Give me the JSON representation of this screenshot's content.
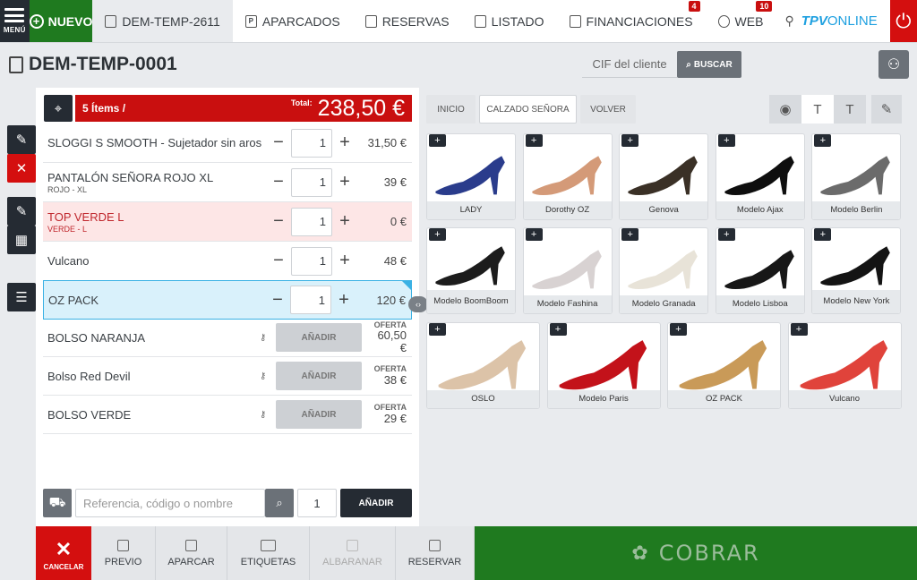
{
  "topbar": {
    "menu_label": "MENÚ",
    "nuevo_label": "NUEVO",
    "tabs": [
      {
        "label": "DEM-TEMP-2611",
        "icon": "ticket-icon"
      },
      {
        "label": "APARCADOS",
        "icon": "parking-icon"
      },
      {
        "label": "RESERVAS",
        "icon": "reservation-icon"
      },
      {
        "label": "LISTADO",
        "icon": "list-icon"
      },
      {
        "label": "FINANCIACIONES",
        "icon": "financing-icon",
        "badge": "4"
      },
      {
        "label": "WEB",
        "icon": "web-icon",
        "badge": "10"
      }
    ],
    "logo_a": "TPV",
    "logo_b": "ONLINE"
  },
  "header": {
    "doc_title": "DEM-TEMP-0001",
    "cif_placeholder": "CIF del cliente",
    "search_label": "BUSCAR"
  },
  "ticket": {
    "items_count": "5 Ítems /",
    "total_label": "Total:",
    "total": "238,50 €",
    "lines": [
      {
        "name": "SLOGGI S SMOOTH - Sujetador sin aros",
        "sub": "",
        "qty": "1",
        "price": "31,50 €"
      },
      {
        "name": "PANTALÓN SEÑORA ROJO XL",
        "sub": "ROJO - XL",
        "qty": "1",
        "price": "39 €"
      },
      {
        "name": "TOP VERDE L",
        "sub": "VERDE - L",
        "qty": "1",
        "price": "0 €"
      },
      {
        "name": "Vulcano",
        "sub": "",
        "qty": "1",
        "price": "48 €"
      },
      {
        "name": "OZ PACK",
        "sub": "",
        "qty": "1",
        "price": "120 €"
      }
    ],
    "promos": [
      {
        "name": "BOLSO NARANJA",
        "add": "AÑADIR",
        "offer_label": "OFERTA",
        "price": "60,50 €"
      },
      {
        "name": "Bolso Red Devil",
        "add": "AÑADIR",
        "offer_label": "OFERTA",
        "price": "38 €"
      },
      {
        "name": "BOLSO VERDE",
        "add": "AÑADIR",
        "offer_label": "OFERTA",
        "price": "29 €"
      }
    ],
    "ref_placeholder": "Referencia, código o nombre",
    "add_qty": "1",
    "add_label": "AÑADIR"
  },
  "catalog": {
    "nav": [
      "INICIO",
      "CALZADO SEÑORA",
      "VOLVER"
    ],
    "products": [
      {
        "name": "LADY",
        "color": "#2a3c8c"
      },
      {
        "name": "Dorothy OZ",
        "color": "#d49a78"
      },
      {
        "name": "Genova",
        "color": "#3a3026"
      },
      {
        "name": "Modelo Ajax",
        "color": "#0e0e0e"
      },
      {
        "name": "Modelo Berlin",
        "color": "#6b6b6b"
      },
      {
        "name": "Modelo BoomBoom",
        "color": "#1c1c1c"
      },
      {
        "name": "Modelo Fashina",
        "color": "#d8d2d2"
      },
      {
        "name": "Modelo Granada",
        "color": "#e8e3d8"
      },
      {
        "name": "Modelo Lisboa",
        "color": "#171717"
      },
      {
        "name": "Modelo New York",
        "color": "#141414"
      },
      {
        "name": "OSLO",
        "color": "#dcc3a8"
      },
      {
        "name": "Modelo Paris",
        "color": "#c3121a"
      },
      {
        "name": "OZ PACK",
        "color": "#c99a58"
      },
      {
        "name": "Vulcano",
        "color": "#e0433b"
      }
    ]
  },
  "bottom": {
    "cancel": "CANCELAR",
    "actions": [
      "PREVIO",
      "APARCAR",
      "ETIQUETAS",
      "ALBARANAR",
      "RESERVAR"
    ],
    "cobrar": "COBRAR"
  }
}
